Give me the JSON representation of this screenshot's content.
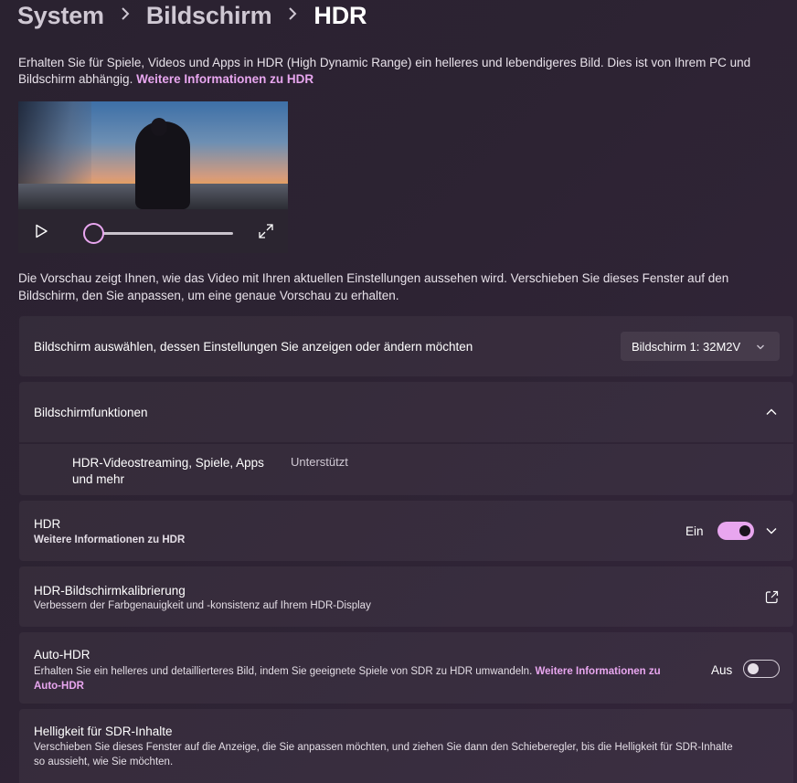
{
  "breadcrumb": {
    "items": [
      "System",
      "Bildschirm"
    ],
    "current": "HDR"
  },
  "intro": {
    "text": "Erhalten Sie für Spiele, Videos und Apps in HDR (High Dynamic Range) ein helleres und lebendigeres Bild. Dies ist von Ihrem PC und Bildschirm abhängig. ",
    "link": "Weitere Informationen zu HDR"
  },
  "video": {
    "progress": 0
  },
  "preview_note": "Die Vorschau zeigt Ihnen, wie das Video mit Ihren aktuellen Einstellungen aussehen wird. Verschieben Sie dieses Fenster auf den Bildschirm, den Sie anpassen, um eine genaue Vorschau zu erhalten.",
  "display_select": {
    "label": "Bildschirm auswählen, dessen Einstellungen Sie anzeigen oder ändern möchten",
    "value": "Bildschirm 1: 32M2V"
  },
  "capabilities": {
    "title": "Bildschirmfunktionen",
    "feature_line1": "HDR-Videostreaming, Spiele, Apps",
    "feature_line2": "und mehr",
    "status": "Unterstützt"
  },
  "hdr": {
    "title": "HDR",
    "link": "Weitere Informationen zu HDR",
    "state": "Ein"
  },
  "calibration": {
    "title": "HDR-Bildschirmkalibrierung",
    "subtitle": "Verbessern der Farbgenauigkeit und -konsistenz auf Ihrem HDR-Display"
  },
  "auto_hdr": {
    "title": "Auto-HDR",
    "subtitle": "Erhalten Sie ein helleres und detaillierteres Bild, indem Sie geeignete Spiele von SDR zu HDR umwandeln. ",
    "link_line1": "Weitere Informationen zu",
    "link_line2": "Auto-HDR",
    "state": "Aus"
  },
  "sdr_brightness": {
    "title": "Helligkeit für SDR-Inhalte",
    "subtitle_line1": "Verschieben Sie dieses Fenster auf die Anzeige, die Sie anpassen möchten, und ziehen Sie dann den Schieberegler, bis die Helligkeit für SDR-Inhalte",
    "subtitle_line2": "so aussieht, wie Sie möchten."
  },
  "colors": {
    "accent": "#e8a6ef",
    "background": "#2d2333",
    "card": "#3a3040"
  },
  "icons": [
    "play-icon",
    "fullscreen-icon",
    "chevron-down-icon",
    "chevron-up-icon",
    "external-link-icon"
  ]
}
